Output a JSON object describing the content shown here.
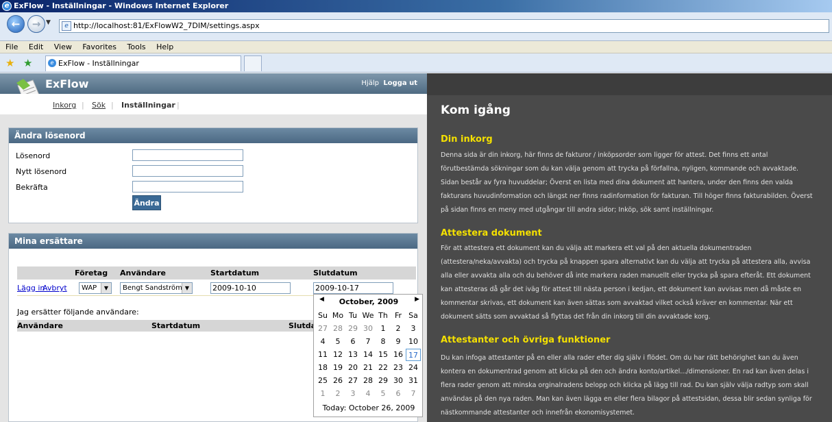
{
  "window": {
    "title": "ExFlow - Inställningar - Windows Internet Explorer"
  },
  "browser": {
    "address": "http://localhost:81/ExFlowW2_7DIM/settings.aspx",
    "menu": [
      "File",
      "Edit",
      "View",
      "Favorites",
      "Tools",
      "Help"
    ],
    "tab_title": "ExFlow - Inställningar"
  },
  "app": {
    "brand": "ExFlow",
    "help": "Hjälp",
    "logout": "Logga ut",
    "nav": [
      "Inkorg",
      "Sök",
      "Inställningar"
    ]
  },
  "password_panel": {
    "title": "Ändra lösenord",
    "labels": [
      "Lösenord",
      "Nytt lösenord",
      "Bekräfta"
    ],
    "button": "Ändra"
  },
  "substitutes_panel": {
    "title": "Mina ersättare",
    "headers": [
      "Företag",
      "Användare",
      "Startdatum",
      "Slutdatum"
    ],
    "add_link": "Lägg in",
    "cancel_link": "Avbryt",
    "company": "WAP",
    "user": "Bengt Sandström",
    "start_date": "2009-10-10",
    "end_date": "2009-10-17",
    "sub_text": "Jag ersätter följande användare:",
    "grid2_headers": [
      "Användare",
      "Startdatum",
      "Slutdat"
    ]
  },
  "calendar": {
    "title": "October, 2009",
    "weekdays": [
      "Su",
      "Mo",
      "Tu",
      "We",
      "Th",
      "Fr",
      "Sa"
    ],
    "weeks": [
      [
        "27",
        "28",
        "29",
        "30",
        "1",
        "2",
        "3"
      ],
      [
        "4",
        "5",
        "6",
        "7",
        "8",
        "9",
        "10"
      ],
      [
        "11",
        "12",
        "13",
        "14",
        "15",
        "16",
        "17"
      ],
      [
        "18",
        "19",
        "20",
        "21",
        "22",
        "23",
        "24"
      ],
      [
        "25",
        "26",
        "27",
        "28",
        "29",
        "30",
        "31"
      ],
      [
        "1",
        "2",
        "3",
        "4",
        "5",
        "6",
        "7"
      ]
    ],
    "selected": "17",
    "today_text": "Today: October 26, 2009"
  },
  "help": {
    "title": "Kom igång",
    "sections": [
      {
        "heading": "Din inkorg",
        "text": "Denna sida är din inkorg, här finns de fakturor / inköpsorder som ligger för attest. Det finns ett antal förutbestämda sökningar som du kan välja genom att trycka på förfallna, nyligen, kommande och avvaktade. Sidan består av fyra huvuddelar; Överst en lista med dina dokument att hantera, under den finns den valda fakturans huvudinformation och längst ner finns radinformation för fakturan. Till höger finns fakturabilden. Överst på sidan finns en meny med utgångar till andra sidor; Inköp, sök samt inställningar."
      },
      {
        "heading": "Attestera dokument",
        "text": "För att attestera ett dokument kan du välja att markera ett val på den aktuella dokumentraden (attestera/neka/avvakta) och trycka på knappen spara alternativt kan du välja att trycka på attestera alla, avvisa alla eller avvakta alla och du behöver då inte markera raden manuellt eller trycka på spara efteråt. Ett dokument kan attesteras då går det iväg för attest till nästa person i kedjan, ett dokument kan avvisas men då måste en kommentar skrivas, ett dokument kan även sättas som avvaktad vilket också kräver en kommentar. När ett dokument sätts som avvaktad så flyttas det från din inkorg till din avvaktade korg."
      },
      {
        "heading": "Attestanter och övriga funktioner",
        "text": "Du kan infoga attestanter på en eller alla rader efter dig själv i flödet. Om du har rätt behörighet kan du även kontera en dokumentrad genom att klicka på den och ändra konto/artikel.../dimensioner. En rad kan även delas i flera rader genom att minska orginalradens belopp och klicka på lägg till rad. Du kan själv välja radtyp som skall användas på den nya raden. Man kan även lägga en eller flera bilagor på attestsidan, dessa blir sedan synliga för nästkommande attestanter och innefrån ekonomisystemet."
      }
    ]
  }
}
